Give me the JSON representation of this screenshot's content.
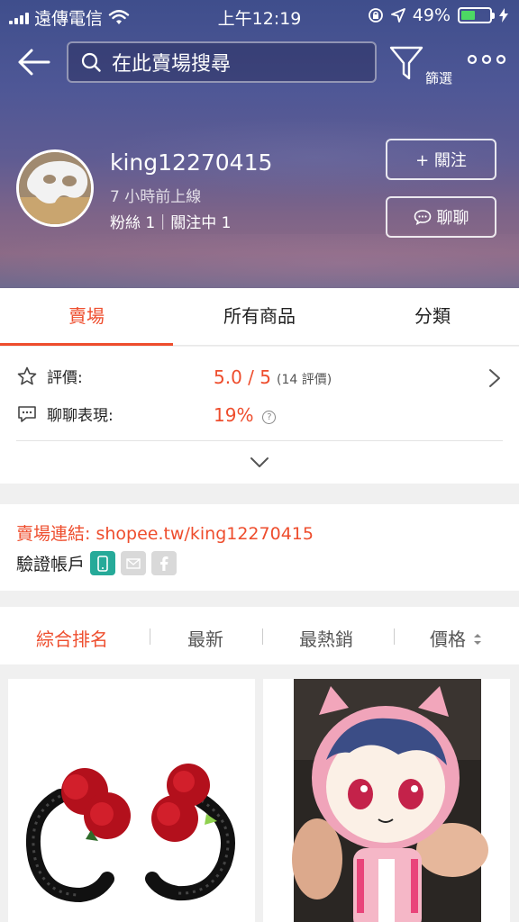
{
  "status_bar": {
    "carrier": "遠傳電信",
    "time": "上午12:19",
    "battery_percent": "49%",
    "battery_level": 0.49
  },
  "nav": {
    "search_placeholder": "在此賣場搜尋",
    "filter_label": "篩選"
  },
  "shop": {
    "name": "king12270415",
    "last_online": "7 小時前上線",
    "followers": "粉絲 1｜關注中 1",
    "follow_label": "+ 關注",
    "chat_label": "聊聊"
  },
  "tabs": [
    {
      "label": "賣場",
      "active": true
    },
    {
      "label": "所有商品",
      "active": false
    },
    {
      "label": "分類",
      "active": false
    }
  ],
  "rating": {
    "rating_label": "評價:",
    "rating_value": "5.0 / 5",
    "rating_count": "(14 評價)",
    "chat_label": "聊聊表現:",
    "chat_value": "19%"
  },
  "shop_link": {
    "text": "賣場連結: shopee.tw/king12270415"
  },
  "verification": {
    "label": "驗證帳戶",
    "badges": [
      {
        "icon": "phone-icon",
        "color": "#26aa99",
        "verified": true
      },
      {
        "icon": "mail-icon",
        "color": "#d9d9d9",
        "verified": false
      },
      {
        "icon": "facebook-icon",
        "color": "#d9d9d9",
        "verified": false
      }
    ]
  },
  "sort": {
    "items": [
      {
        "label": "綜合排名",
        "active": true
      },
      {
        "label": "最新",
        "active": false
      },
      {
        "label": "最熱銷",
        "active": false
      },
      {
        "label": "價格",
        "active": false
      }
    ]
  },
  "colors": {
    "accent": "#ee4d2d",
    "verified_badge": "#26aa99"
  }
}
